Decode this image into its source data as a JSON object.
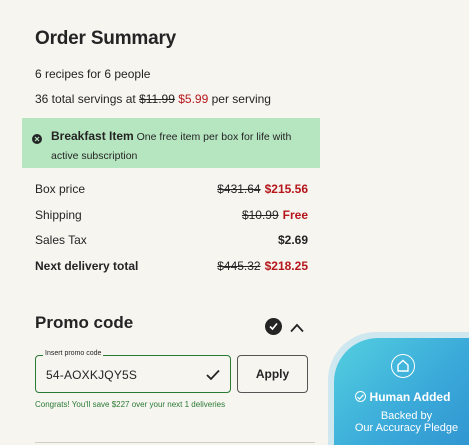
{
  "order_summary": {
    "title": "Order Summary",
    "recipes_line": "6 recipes for 6 people",
    "servings_prefix": "36 total servings at",
    "servings_old_price": "$11.99",
    "servings_new_price": "$5.99",
    "servings_suffix": "per serving"
  },
  "banner": {
    "title": "Breakfast Item",
    "text": "One free item per box for life with active subscription",
    "icon": "close-circle-icon",
    "background": "#b6e6c0"
  },
  "rows": [
    {
      "label": "Box price",
      "old": "$431.64",
      "new": "$215.56",
      "new_color": "#b5161b"
    },
    {
      "label": "Shipping",
      "old": "$10.99",
      "new": "Free",
      "new_color": "#b5161b"
    },
    {
      "label": "Sales Tax",
      "old": "",
      "new": "$2.69",
      "new_color": "#242424"
    },
    {
      "label": "Next delivery total",
      "old": "$445.32",
      "new": "$218.25",
      "new_color": "#b5161b"
    }
  ],
  "promo": {
    "title": "Promo code",
    "input_label": "Insert promo code",
    "input_value": "54-AOXKJQY5S",
    "apply_label": "Apply",
    "note": "Congrats! You'll save $227 over your next 1 deliveries",
    "accent": "#2a7a34"
  },
  "badge": {
    "title": "Human Added",
    "line1": "Backed by",
    "line2": "Our Accuracy Pledge",
    "icon": "house-icon"
  }
}
